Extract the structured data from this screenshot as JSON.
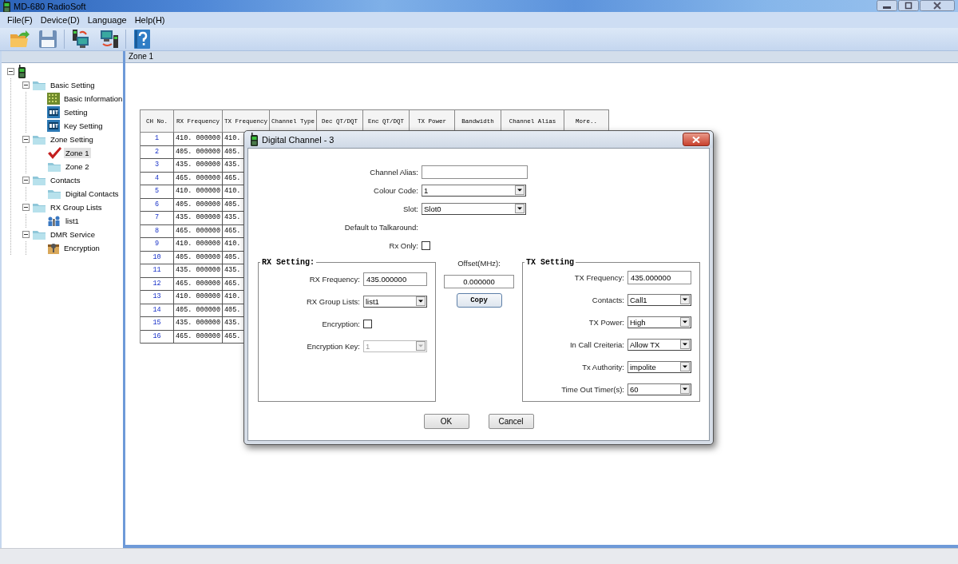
{
  "window": {
    "title": "MD-680 RadioSoft"
  },
  "menu": [
    {
      "label": "File(F)"
    },
    {
      "label": "Device(D)"
    },
    {
      "label": "Language"
    },
    {
      "label": "Help(H)"
    }
  ],
  "content_header": "Zone 1",
  "tree": {
    "kind": "radio",
    "expanded": true,
    "children": [
      {
        "label": "Basic Setting",
        "kind": "folder",
        "expanded": true,
        "selected": false,
        "children": [
          {
            "label": "Basic Information",
            "kind": "grid",
            "selected": false
          },
          {
            "label": "Setting",
            "kind": "settings",
            "selected": false
          },
          {
            "label": "Key Setting",
            "kind": "settings",
            "selected": false
          }
        ]
      },
      {
        "label": "Zone Setting",
        "kind": "folder",
        "expanded": true,
        "selected": false,
        "children": [
          {
            "label": "Zone 1",
            "kind": "check",
            "selected": true
          },
          {
            "label": "Zone 2",
            "kind": "folder",
            "selected": false
          }
        ]
      },
      {
        "label": "Contacts",
        "kind": "folder",
        "expanded": true,
        "selected": false,
        "children": [
          {
            "label": "Digital Contacts",
            "kind": "folder",
            "selected": false
          }
        ]
      },
      {
        "label": "RX Group Lists",
        "kind": "folder",
        "expanded": true,
        "selected": false,
        "children": [
          {
            "label": "list1",
            "kind": "group",
            "selected": false
          }
        ]
      },
      {
        "label": "DMR Service",
        "kind": "folder",
        "expanded": true,
        "selected": false,
        "children": [
          {
            "label": "Encryption",
            "kind": "lock",
            "selected": false
          }
        ]
      }
    ]
  },
  "table": {
    "columns": [
      "CH No.",
      "RX Frequency",
      "TX Frequency",
      "Channel Type",
      "Dec QT/DQT",
      "Enc QT/DQT",
      "TX Power",
      "Bandwidth",
      "Channel Alias",
      "More.."
    ],
    "rows": [
      {
        "cells": [
          "1",
          "410. 000000",
          "410."
        ]
      },
      {
        "cells": [
          "2",
          "405. 000000",
          "405."
        ]
      },
      {
        "cells": [
          "3",
          "435. 000000",
          "435."
        ]
      },
      {
        "cells": [
          "4",
          "465. 000000",
          "465."
        ]
      },
      {
        "cells": [
          "5",
          "410. 000000",
          "410."
        ]
      },
      {
        "cells": [
          "6",
          "405. 000000",
          "405."
        ]
      },
      {
        "cells": [
          "7",
          "435. 000000",
          "435."
        ]
      },
      {
        "cells": [
          "8",
          "465. 000000",
          "465."
        ]
      },
      {
        "cells": [
          "9",
          "410. 000000",
          "410."
        ]
      },
      {
        "cells": [
          "10",
          "405. 000000",
          "405."
        ]
      },
      {
        "cells": [
          "11",
          "435. 000000",
          "435."
        ]
      },
      {
        "cells": [
          "12",
          "465. 000000",
          "465."
        ]
      },
      {
        "cells": [
          "13",
          "410. 000000",
          "410."
        ]
      },
      {
        "cells": [
          "14",
          "405. 000000",
          "405."
        ]
      },
      {
        "cells": [
          "15",
          "435. 000000",
          "435."
        ]
      },
      {
        "cells": [
          "16",
          "465. 000000",
          "465."
        ]
      }
    ]
  },
  "dialog": {
    "title": "Digital Channel  -  3",
    "fields": [
      {
        "kind": "text",
        "label": "Channel Alias:"
      },
      {
        "kind": "select",
        "label": "Colour Code:",
        "value": "1",
        "disabled": false
      },
      {
        "kind": "select",
        "label": "Slot:",
        "value": "Slot0",
        "disabled": false
      },
      {
        "kind": "label",
        "label": "Default to Talkaround:"
      },
      {
        "kind": "checkbox",
        "label": "Rx Only:",
        "checked": false
      }
    ],
    "rx_setting": {
      "title": "RX Setting:",
      "fields": [
        {
          "kind": "text",
          "label": "RX Frequency:",
          "value": "435.000000"
        },
        {
          "kind": "select",
          "label": "RX Group Lists:",
          "value": "list1",
          "disabled": false
        },
        {
          "kind": "checkbox",
          "label": "Encryption:",
          "checked": false
        },
        {
          "kind": "select",
          "label": "Encryption Key:",
          "value": "1",
          "disabled": true
        }
      ]
    },
    "offset": {
      "label": "Offset(MHz):",
      "value": "0.000000",
      "button": "Copy"
    },
    "tx_setting": {
      "title": "TX Setting",
      "fields": [
        {
          "kind": "text",
          "label": "TX Frequency:",
          "value": "435.000000"
        },
        {
          "kind": "select",
          "label": "Contacts:",
          "value": "Call1",
          "disabled": false
        },
        {
          "kind": "select",
          "label": "TX Power:",
          "value": "High",
          "disabled": false
        },
        {
          "kind": "select",
          "label": "In Call Creiteria:",
          "value": "Allow TX",
          "disabled": false
        },
        {
          "kind": "select",
          "label": "Tx Authority:",
          "value": "impolite",
          "disabled": false
        },
        {
          "kind": "select",
          "label": "Time Out Timer(s):",
          "value": "60",
          "disabled": false
        }
      ]
    },
    "buttons": [
      "OK",
      "Cancel"
    ]
  }
}
